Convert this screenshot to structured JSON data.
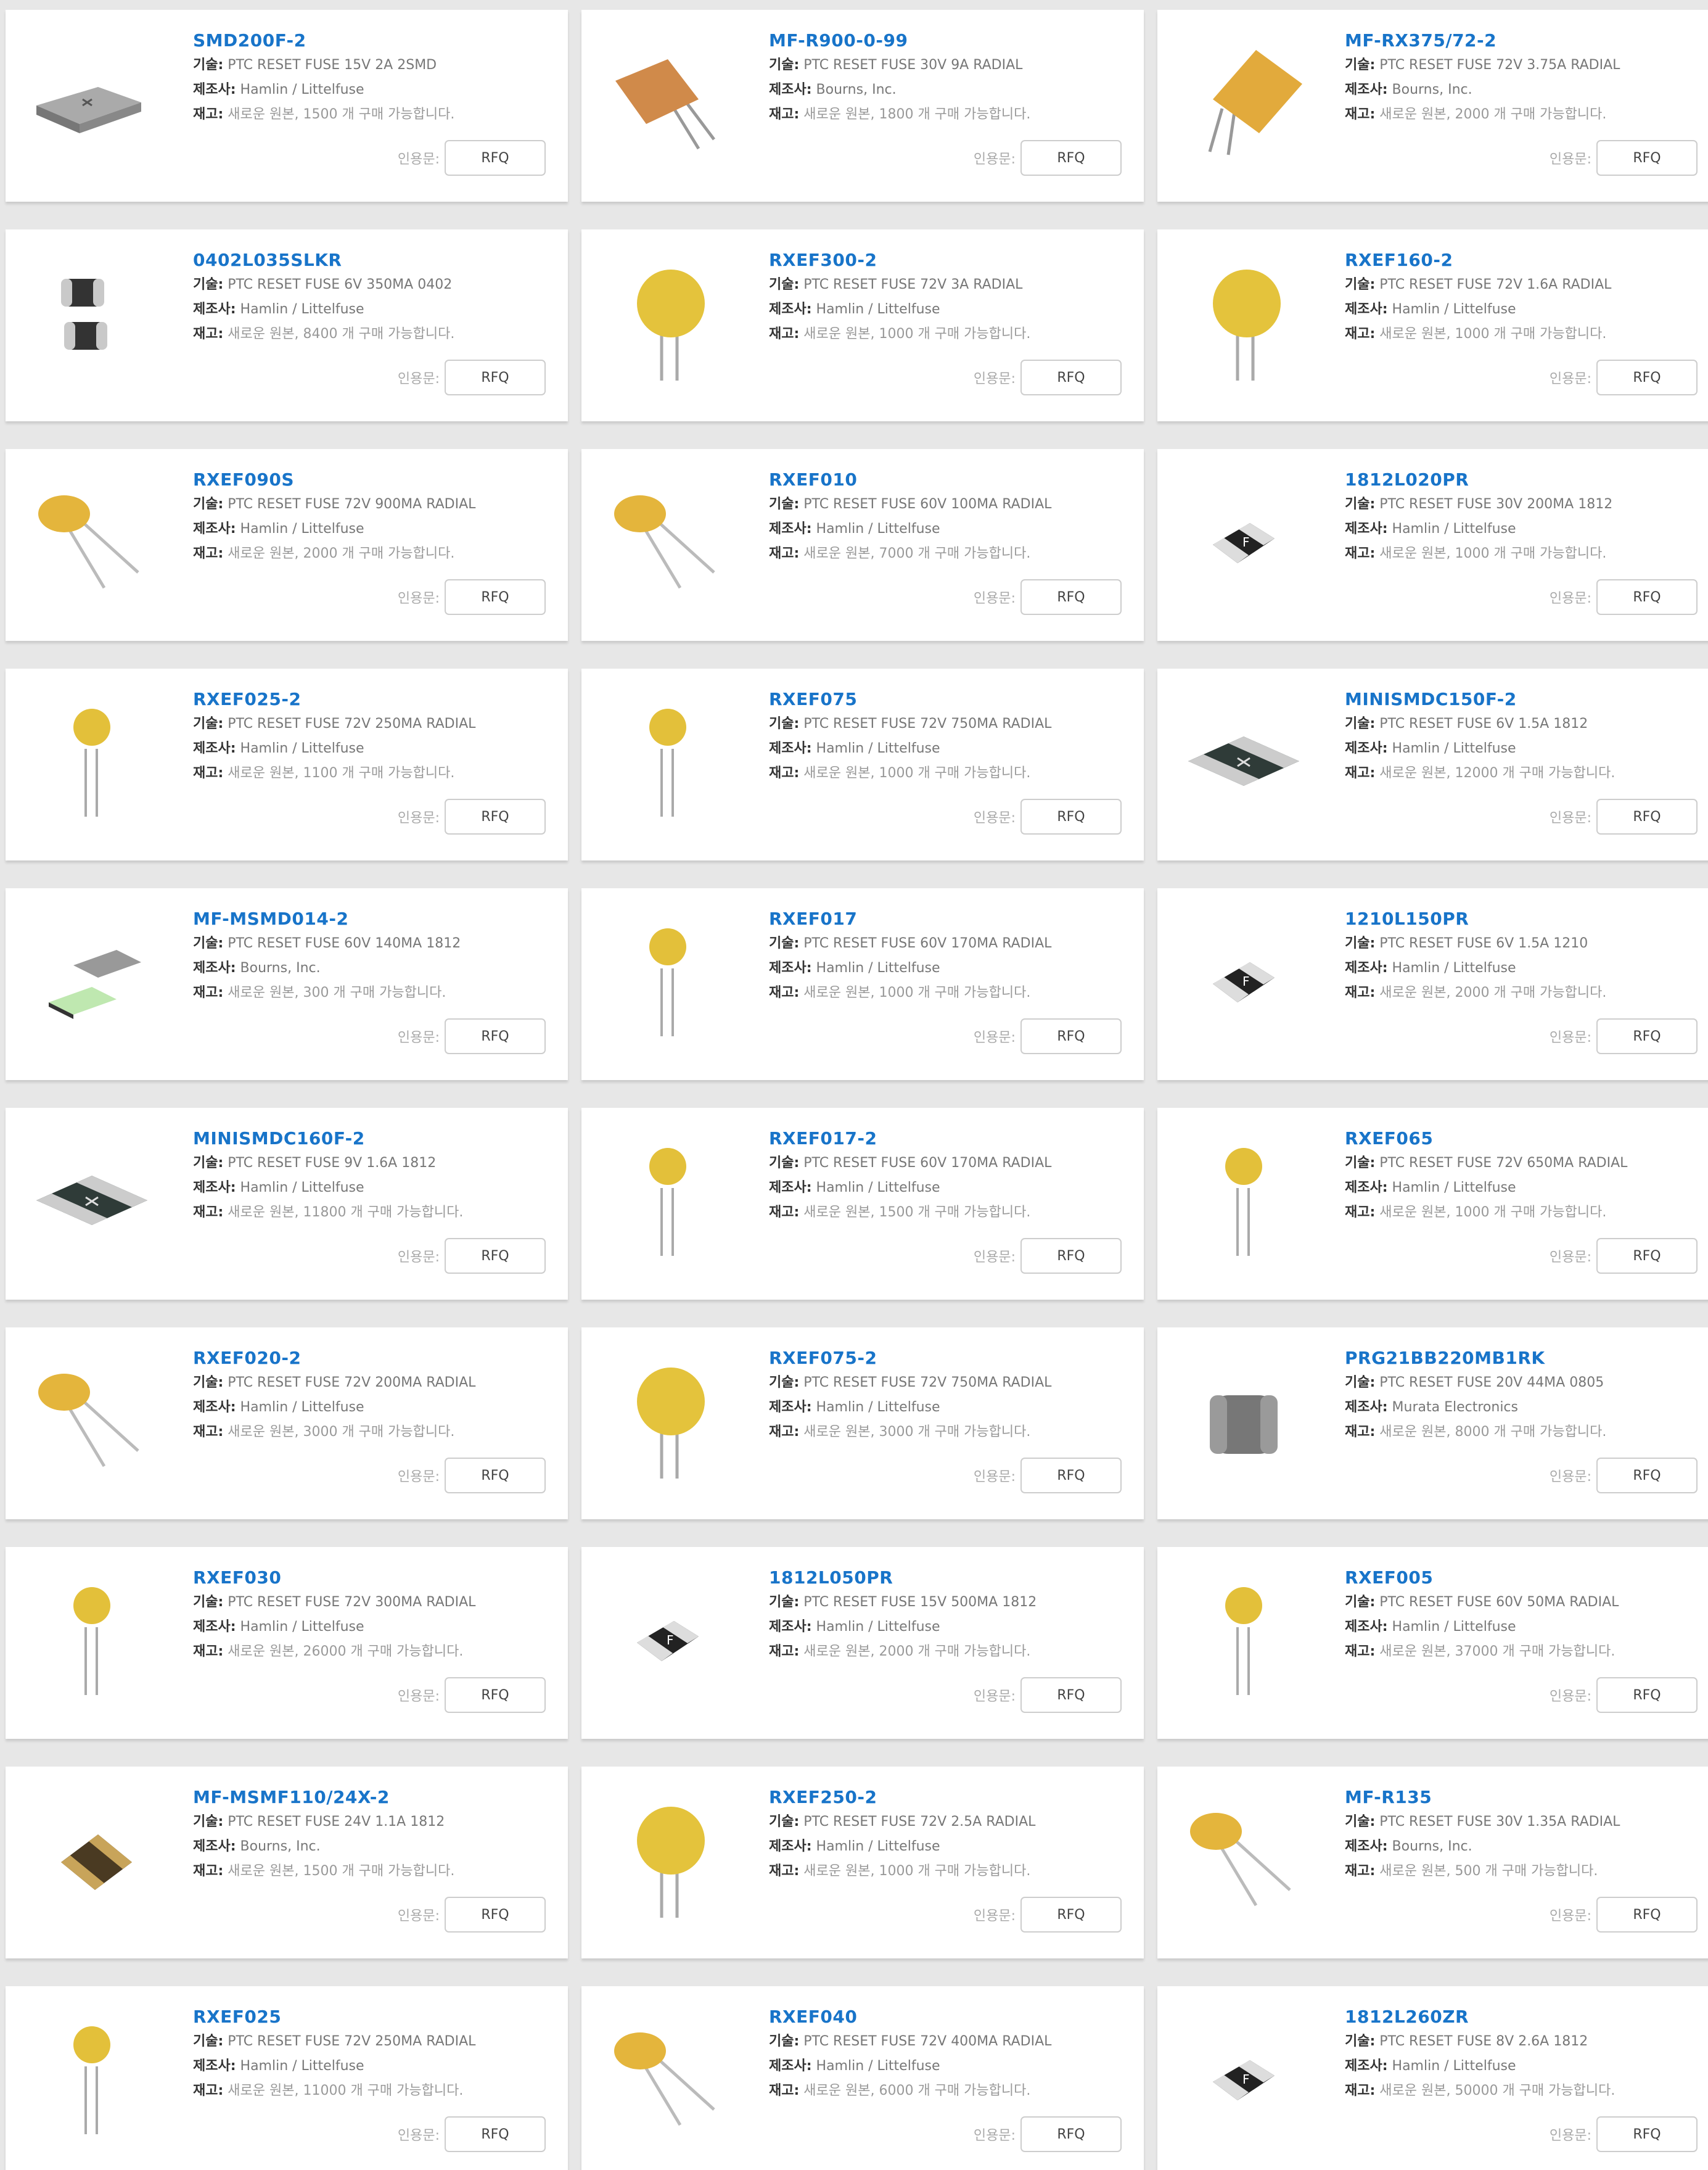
{
  "labels": {
    "tech": "기술:",
    "mfr": "제조사:",
    "stock": "재고:",
    "quote": "인용문:",
    "rfq": "RFQ"
  },
  "products": [
    {
      "part": "SMD200F-2",
      "desc": "PTC RESET FUSE 15V 2A 2SMD",
      "mfr": "Hamlin / Littelfuse",
      "stock": "새로운 원본, 1500 개 구매 가능합니다.",
      "icon": "smd-fuse-gray-icon"
    },
    {
      "part": "MF-R900-0-99",
      "desc": "PTC RESET FUSE 30V 9A RADIAL",
      "mfr": "Bourns, Inc.",
      "stock": "새로운 원본, 1800 개 구매 가능합니다.",
      "icon": "radial-fuse-square-orange-icon"
    },
    {
      "part": "MF-RX375/72-2",
      "desc": "PTC RESET FUSE 72V 3.75A RADIAL",
      "mfr": "Bourns, Inc.",
      "stock": "새로운 원본, 2000 개 구매 가능합니다.",
      "icon": "radial-fuse-square-yellow-icon"
    },
    {
      "part": "0402L035SLKR",
      "desc": "PTC RESET FUSE 6V 350MA 0402",
      "mfr": "Hamlin / Littelfuse",
      "stock": "새로운 원본, 8400 개 구매 가능합니다.",
      "icon": "chip-fuse-pair-icon"
    },
    {
      "part": "RXEF300-2",
      "desc": "PTC RESET FUSE 72V 3A RADIAL",
      "mfr": "Hamlin / Littelfuse",
      "stock": "새로운 원본, 1000 개 구매 가능합니다.",
      "icon": "radial-fuse-disc-yellow-icon"
    },
    {
      "part": "RXEF160-2",
      "desc": "PTC RESET FUSE 72V 1.6A RADIAL",
      "mfr": "Hamlin / Littelfuse",
      "stock": "새로운 원본, 1000 개 구매 가능합니다.",
      "icon": "radial-fuse-disc-yellow-icon"
    },
    {
      "part": "RXEF090S",
      "desc": "PTC RESET FUSE 72V 900MA RADIAL",
      "mfr": "Hamlin / Littelfuse",
      "stock": "새로운 원본, 2000 개 구매 가능합니다.",
      "icon": "radial-fuse-disc-tilted-icon"
    },
    {
      "part": "RXEF010",
      "desc": "PTC RESET FUSE 60V 100MA RADIAL",
      "mfr": "Hamlin / Littelfuse",
      "stock": "새로운 원본, 7000 개 구매 가능합니다.",
      "icon": "radial-fuse-disc-tilted-icon"
    },
    {
      "part": "1812L020PR",
      "desc": "PTC RESET FUSE 30V 200MA 1812",
      "mfr": "Hamlin / Littelfuse",
      "stock": "새로운 원본, 1000 개 구매 가능합니다.",
      "icon": "smd-fuse-black-icon"
    },
    {
      "part": "RXEF025-2",
      "desc": "PTC RESET FUSE 72V 250MA RADIAL",
      "mfr": "Hamlin / Littelfuse",
      "stock": "새로운 원본, 1100 개 구매 가능합니다.",
      "icon": "radial-fuse-disc-small-icon"
    },
    {
      "part": "RXEF075",
      "desc": "PTC RESET FUSE 72V 750MA RADIAL",
      "mfr": "Hamlin / Littelfuse",
      "stock": "새로운 원본, 1000 개 구매 가능합니다.",
      "icon": "radial-fuse-disc-small-icon"
    },
    {
      "part": "MINISMDC150F-2",
      "desc": "PTC RESET FUSE 6V 1.5A 1812",
      "mfr": "Hamlin / Littelfuse",
      "stock": "새로운 원본, 12000 개 구매 가능합니다.",
      "icon": "smd-fuse-dark-green-icon"
    },
    {
      "part": "MF-MSMD014-2",
      "desc": "PTC RESET FUSE 60V 140MA 1812",
      "mfr": "Bourns, Inc.",
      "stock": "새로운 원본, 300 개 구매 가능합니다.",
      "icon": "smd-fuse-pair-icon"
    },
    {
      "part": "RXEF017",
      "desc": "PTC RESET FUSE 60V 170MA RADIAL",
      "mfr": "Hamlin / Littelfuse",
      "stock": "새로운 원본, 1000 개 구매 가능합니다.",
      "icon": "radial-fuse-disc-small-icon"
    },
    {
      "part": "1210L150PR",
      "desc": "PTC RESET FUSE 6V 1.5A 1210",
      "mfr": "Hamlin / Littelfuse",
      "stock": "새로운 원본, 2000 개 구매 가능합니다.",
      "icon": "smd-fuse-black-icon"
    },
    {
      "part": "MINISMDC160F-2",
      "desc": "PTC RESET FUSE 9V 1.6A 1812",
      "mfr": "Hamlin / Littelfuse",
      "stock": "새로운 원본, 11800 개 구매 가능합니다.",
      "icon": "smd-fuse-dark-green-icon"
    },
    {
      "part": "RXEF017-2",
      "desc": "PTC RESET FUSE 60V 170MA RADIAL",
      "mfr": "Hamlin / Littelfuse",
      "stock": "새로운 원본, 1500 개 구매 가능합니다.",
      "icon": "radial-fuse-disc-small-icon"
    },
    {
      "part": "RXEF065",
      "desc": "PTC RESET FUSE 72V 650MA RADIAL",
      "mfr": "Hamlin / Littelfuse",
      "stock": "새로운 원본, 1000 개 구매 가능합니다.",
      "icon": "radial-fuse-disc-small-icon"
    },
    {
      "part": "RXEF020-2",
      "desc": "PTC RESET FUSE 72V 200MA RADIAL",
      "mfr": "Hamlin / Littelfuse",
      "stock": "새로운 원본, 3000 개 구매 가능합니다.",
      "icon": "radial-fuse-disc-tilted-icon"
    },
    {
      "part": "RXEF075-2",
      "desc": "PTC RESET FUSE 72V 750MA RADIAL",
      "mfr": "Hamlin / Littelfuse",
      "stock": "새로운 원본, 3000 개 구매 가능합니다.",
      "icon": "radial-fuse-disc-yellow-icon"
    },
    {
      "part": "PRG21BB220MB1RK",
      "desc": "PTC RESET FUSE 20V 44MA 0805",
      "mfr": "Murata Electronics",
      "stock": "새로운 원본, 8000 개 구매 가능합니다.",
      "icon": "chip-fuse-gray-icon"
    },
    {
      "part": "RXEF030",
      "desc": "PTC RESET FUSE 72V 300MA RADIAL",
      "mfr": "Hamlin / Littelfuse",
      "stock": "새로운 원본, 26000 개 구매 가능합니다.",
      "icon": "radial-fuse-disc-small-icon"
    },
    {
      "part": "1812L050PR",
      "desc": "PTC RESET FUSE 15V 500MA 1812",
      "mfr": "Hamlin / Littelfuse",
      "stock": "새로운 원본, 2000 개 구매 가능합니다.",
      "icon": "smd-fuse-black-icon"
    },
    {
      "part": "RXEF005",
      "desc": "PTC RESET FUSE 60V 50MA RADIAL",
      "mfr": "Hamlin / Littelfuse",
      "stock": "새로운 원본, 37000 개 구매 가능합니다.",
      "icon": "radial-fuse-disc-small-icon"
    },
    {
      "part": "MF-MSMF110/24X-2",
      "desc": "PTC RESET FUSE 24V 1.1A 1812",
      "mfr": "Bourns, Inc.",
      "stock": "새로운 원본, 1500 개 구매 가능합니다.",
      "icon": "smd-fuse-brown-icon"
    },
    {
      "part": "RXEF250-2",
      "desc": "PTC RESET FUSE 72V 2.5A RADIAL",
      "mfr": "Hamlin / Littelfuse",
      "stock": "새로운 원본, 1000 개 구매 가능합니다.",
      "icon": "radial-fuse-disc-yellow-icon"
    },
    {
      "part": "MF-R135",
      "desc": "PTC RESET FUSE 30V 1.35A RADIAL",
      "mfr": "Bourns, Inc.",
      "stock": "새로운 원본, 500 개 구매 가능합니다.",
      "icon": "radial-fuse-disc-tilted-icon"
    },
    {
      "part": "RXEF025",
      "desc": "PTC RESET FUSE 72V 250MA RADIAL",
      "mfr": "Hamlin / Littelfuse",
      "stock": "새로운 원본, 11000 개 구매 가능합니다.",
      "icon": "radial-fuse-disc-small-icon"
    },
    {
      "part": "RXEF040",
      "desc": "PTC RESET FUSE 72V 400MA RADIAL",
      "mfr": "Hamlin / Littelfuse",
      "stock": "새로운 원본, 6000 개 구매 가능합니다.",
      "icon": "radial-fuse-disc-tilted-icon"
    },
    {
      "part": "1812L260ZR",
      "desc": "PTC RESET FUSE 8V 2.6A 1812",
      "mfr": "Hamlin / Littelfuse",
      "stock": "새로운 원본, 50000 개 구매 가능합니다.",
      "icon": "smd-fuse-black-icon"
    }
  ]
}
